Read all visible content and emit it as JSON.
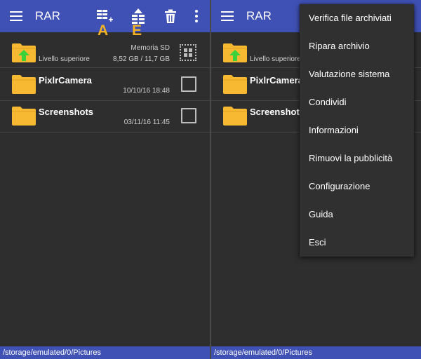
{
  "colors": {
    "appbar": "#3f51b5",
    "background": "#2e2e2e",
    "folder": "#f7b932",
    "arrow": "#3ad13a",
    "annotation": "#f3b324"
  },
  "left": {
    "app_title": "RAR",
    "toolbar": {
      "menu_icon": "hamburger-menu-icon",
      "add_icon": "add-to-archive-icon",
      "extract_icon": "extract-files-icon",
      "delete_icon": "trash-icon",
      "more_icon": "overflow-menu-icon"
    },
    "annotations": {
      "add_letter": "A",
      "extract_letter": "E"
    },
    "parent": {
      "label": "Livello superiore",
      "storage_name": "Memoria SD",
      "storage_usage": "8,52 GB / 11,7 GB"
    },
    "items": [
      {
        "name": "PixlrCamera",
        "date": "10/10/16 18:48"
      },
      {
        "name": "Screenshots",
        "date": "03/11/16 11:45"
      }
    ],
    "path": "/storage/emulated/0/Pictures"
  },
  "right": {
    "app_title": "RAR",
    "parent": {
      "label": "Livello superiore"
    },
    "items": [
      {
        "name": "PixlrCamera"
      },
      {
        "name": "Screenshots"
      }
    ],
    "path": "/storage/emulated/0/Pictures",
    "menu_items": [
      "Verifica file archiviati",
      "Ripara archivio",
      "Valutazione sistema",
      "Condividi",
      "Informazioni",
      "Rimuovi la pubblicità",
      "Configurazione",
      "Guida",
      "Esci"
    ]
  }
}
